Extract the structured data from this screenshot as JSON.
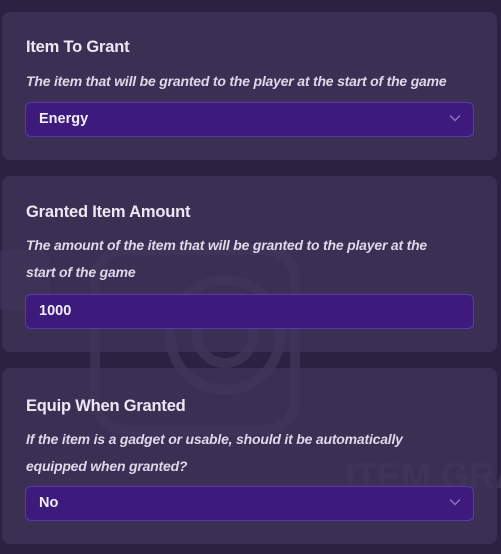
{
  "cards": [
    {
      "title": "Item To Grant",
      "description": "The item that will be granted to the player at the start of the game",
      "control": "select",
      "value": "Energy",
      "icon": "chevron-down-icon"
    },
    {
      "title": "Granted Item Amount",
      "description_lines": [
        "The amount of the item that will be granted to the player at the",
        "start of the game"
      ],
      "control": "number-input",
      "value": "1000"
    },
    {
      "title": "Equip When Granted",
      "description_lines": [
        "If the item is a gadget or usable, should it be automatically",
        "equipped when granted?"
      ],
      "control": "select",
      "value": "No",
      "icon": "chevron-down-icon"
    }
  ],
  "background_watermark_text": "ITEM GRANTER",
  "colors": {
    "page_background": "#2c2140",
    "card_background": "#42345c",
    "field_background": "#3d1b7c",
    "field_border": "#5b3aa6",
    "text": "#ece8f4"
  }
}
